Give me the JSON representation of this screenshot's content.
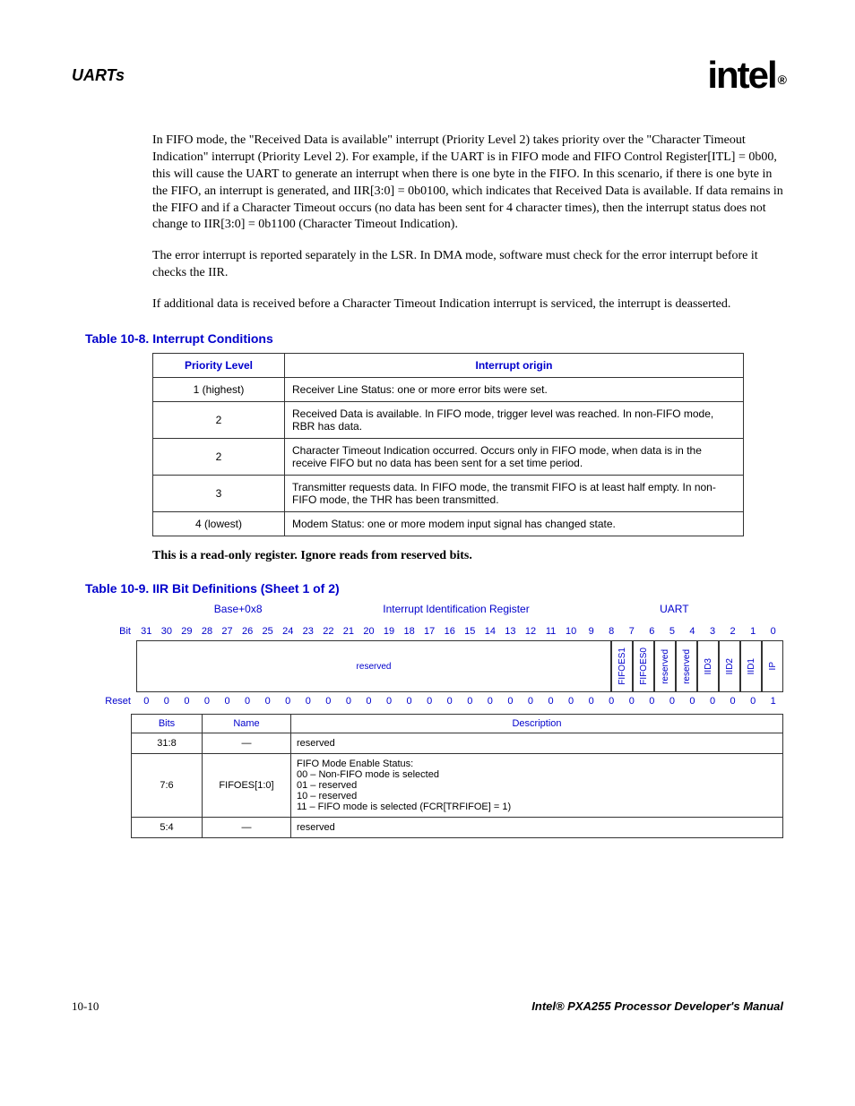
{
  "header": {
    "section": "UARTs",
    "logo": "intel",
    "logo_r": "®"
  },
  "para1": "In FIFO mode, the \"Received Data is available\" interrupt (Priority Level 2) takes priority over the \"Character Timeout Indication\" interrupt (Priority Level 2). For example, if the UART is in FIFO mode and FIFO Control Register[ITL] = 0b00, this will cause the UART to generate an interrupt when there is one byte in the FIFO. In this scenario, if there is one byte in the FIFO, an interrupt is generated, and IIR[3:0] = 0b0100, which indicates that Received Data is available. If data remains in the FIFO and if a Character Timeout occurs (no data has been sent for 4 character times), then the interrupt status does not change to IIR[3:0] = 0b1100 (Character Timeout Indication).",
  "para2": "The error interrupt is reported separately in the LSR. In DMA mode, software must check for the error interrupt before it checks the IIR.",
  "para3": "If additional data is received before a Character Timeout Indication interrupt is serviced, the interrupt is deasserted.",
  "table8": {
    "caption": "Table 10-8. Interrupt Conditions",
    "headers": [
      "Priority Level",
      "Interrupt origin"
    ],
    "rows": [
      {
        "level": "1 (highest)",
        "origin": "Receiver Line Status: one or more error bits were set."
      },
      {
        "level": "2",
        "origin": "Received Data is available. In FIFO mode, trigger level was reached. In non-FIFO mode, RBR has data."
      },
      {
        "level": "2",
        "origin": "Character Timeout Indication occurred. Occurs only in FIFO mode, when data is in the receive FIFO but no data has been sent for a set time period."
      },
      {
        "level": "3",
        "origin": "Transmitter requests data. In FIFO mode, the transmit FIFO is at least half empty. In non-FIFO mode, the THR has been transmitted."
      },
      {
        "level": "4 (lowest)",
        "origin": "Modem Status: one or more modem input signal has changed state."
      }
    ]
  },
  "note": "This is a read-only register. Ignore reads from reserved bits.",
  "table9": {
    "caption": "Table 10-9. IIR Bit Definitions (Sheet 1 of 2)",
    "reg_offset": "Base+0x8",
    "reg_name": "Interrupt Identification Register",
    "reg_block": "UART",
    "bit_label": "Bit",
    "reset_label": "Reset",
    "bits": [
      "31",
      "30",
      "29",
      "28",
      "27",
      "26",
      "25",
      "24",
      "23",
      "22",
      "21",
      "20",
      "19",
      "18",
      "17",
      "16",
      "15",
      "14",
      "13",
      "12",
      "11",
      "10",
      "9",
      "8",
      "7",
      "6",
      "5",
      "4",
      "3",
      "2",
      "1",
      "0"
    ],
    "fields": {
      "reserved": "reserved",
      "f7": "FIFOES1",
      "f6": "FIFOES0",
      "f5": "reserved",
      "f4": "reserved",
      "f3": "IID3",
      "f2": "IID2",
      "f1": "IID1",
      "f0": "IP"
    },
    "reset": [
      "0",
      "0",
      "0",
      "0",
      "0",
      "0",
      "0",
      "0",
      "0",
      "0",
      "0",
      "0",
      "0",
      "0",
      "0",
      "0",
      "0",
      "0",
      "0",
      "0",
      "0",
      "0",
      "0",
      "0",
      "0",
      "0",
      "0",
      "0",
      "0",
      "0",
      "0",
      "1"
    ],
    "def_headers": [
      "Bits",
      "Name",
      "Description"
    ],
    "defs": [
      {
        "bits": "31:8",
        "name": "—",
        "desc": "reserved"
      },
      {
        "bits": "7:6",
        "name": "FIFOES[1:0]",
        "desc": "FIFO Mode Enable Status:\n00 – Non-FIFO mode is selected\n01 – reserved\n10 – reserved\n11 – FIFO mode is selected (FCR[TRFIFOE] = 1)"
      },
      {
        "bits": "5:4",
        "name": "—",
        "desc": "reserved"
      }
    ]
  },
  "footer": {
    "left": "10-10",
    "right": "Intel® PXA255 Processor Developer's Manual"
  }
}
